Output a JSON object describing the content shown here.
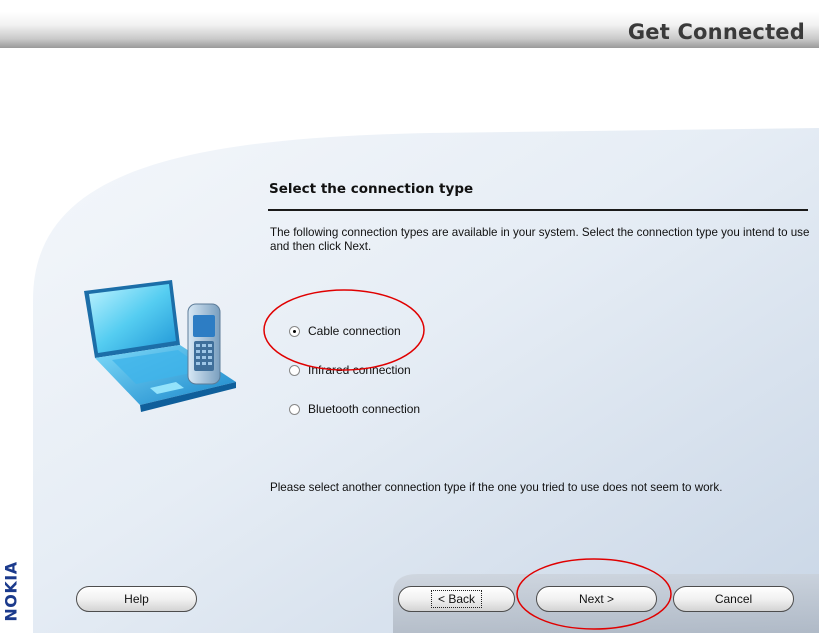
{
  "window": {
    "title": "Get Connected",
    "brand": "NOKIA"
  },
  "step": {
    "title": "Select the connection type",
    "description": "The following connection types are available in your system. Select the connection type you intend to use and then click Next.",
    "options": [
      {
        "label": "Cable connection",
        "selected": true
      },
      {
        "label": "Infrared connection",
        "selected": false
      },
      {
        "label": "Bluetooth connection",
        "selected": false
      }
    ],
    "note": "Please select another connection type if the one you tried to use does not seem to work."
  },
  "buttons": {
    "help": "Help",
    "back": "< Back",
    "next": "Next >",
    "cancel": "Cancel"
  },
  "colors": {
    "brand": "#1b3a8c",
    "annotation_circle": "#e00000"
  },
  "icons": {
    "illustration": "laptop-phone-icon"
  }
}
